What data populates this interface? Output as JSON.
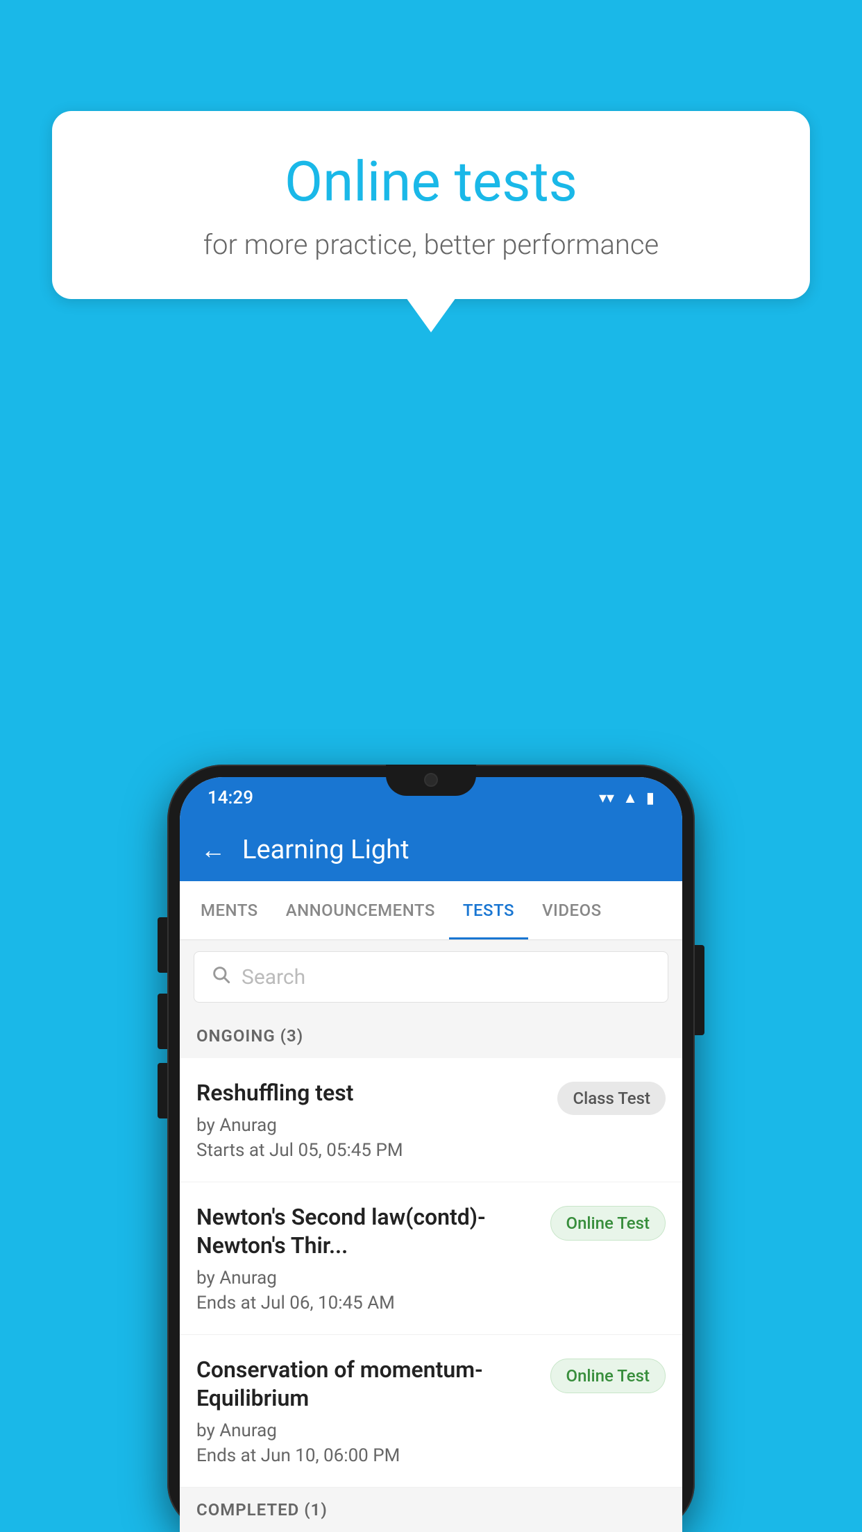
{
  "background_color": "#1ab8e8",
  "speech_bubble": {
    "title": "Online tests",
    "subtitle": "for more practice, better performance"
  },
  "status_bar": {
    "time": "14:29",
    "signal_icon": "▾",
    "wifi_icon": "▾",
    "battery_icon": "▮"
  },
  "app_header": {
    "back_label": "←",
    "title": "Learning Light"
  },
  "tabs": [
    {
      "label": "MENTS",
      "active": false
    },
    {
      "label": "ANNOUNCEMENTS",
      "active": false
    },
    {
      "label": "TESTS",
      "active": true
    },
    {
      "label": "VIDEOS",
      "active": false
    }
  ],
  "search": {
    "placeholder": "Search"
  },
  "ongoing_section": {
    "header": "ONGOING (3)"
  },
  "tests": [
    {
      "name": "Reshuffling test",
      "by": "by Anurag",
      "date": "Starts at  Jul 05, 05:45 PM",
      "badge": "Class Test",
      "badge_type": "class"
    },
    {
      "name": "Newton's Second law(contd)-Newton's Thir...",
      "by": "by Anurag",
      "date": "Ends at  Jul 06, 10:45 AM",
      "badge": "Online Test",
      "badge_type": "online"
    },
    {
      "name": "Conservation of momentum-Equilibrium",
      "by": "by Anurag",
      "date": "Ends at  Jun 10, 06:00 PM",
      "badge": "Online Test",
      "badge_type": "online"
    }
  ],
  "completed_section": {
    "header": "COMPLETED (1)"
  }
}
